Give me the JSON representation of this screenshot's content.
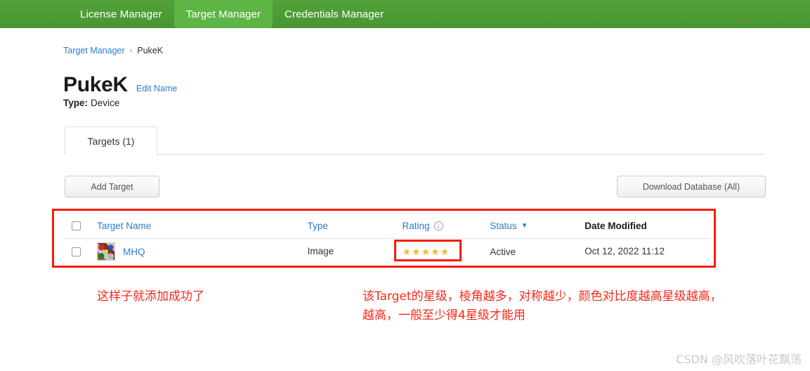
{
  "navbar": {
    "items": [
      {
        "label": "License Manager",
        "active": false
      },
      {
        "label": "Target Manager",
        "active": true
      },
      {
        "label": "Credentials Manager",
        "active": false
      }
    ],
    "bg_color": "#4a9433",
    "active_color": "#5cb544"
  },
  "breadcrumb": {
    "root": "Target Manager",
    "separator": "›",
    "current": "PukeK"
  },
  "header": {
    "title": "PukeK",
    "edit_link": "Edit Name",
    "type_label": "Type:",
    "type_value": "Device"
  },
  "tabs": [
    {
      "label": "Targets (1)",
      "active": true
    }
  ],
  "toolbar": {
    "add_target": "Add Target",
    "download_database": "Download Database (All)"
  },
  "table": {
    "columns": [
      {
        "key": "name",
        "label": "Target Name",
        "style": "link"
      },
      {
        "key": "type",
        "label": "Type",
        "style": "link"
      },
      {
        "key": "rating",
        "label": "Rating",
        "style": "link",
        "icon": "info-icon"
      },
      {
        "key": "status",
        "label": "Status",
        "style": "link",
        "icon": "chevron-down-icon"
      },
      {
        "key": "date",
        "label": "Date Modified",
        "style": "plain"
      }
    ],
    "rows": [
      {
        "name": "MHQ",
        "type": "Image",
        "rating_stars": "★★★★★",
        "rating_value": 5,
        "status": "Active",
        "date": "Oct 12, 2022 11:12",
        "thumbnail": "kaleidoscope-thumbnail",
        "checked": false
      }
    ]
  },
  "annotations": {
    "highlight_color": "#f71d0a",
    "left_note": "这样子就添加成功了",
    "right_note": "该Target的星级，棱角越多，对称越少，颜色对比度越高星级越高，\n越高，一般至少得4星级才能用"
  },
  "watermark": {
    "text": "CSDN @风吹落叶花飘荡"
  }
}
